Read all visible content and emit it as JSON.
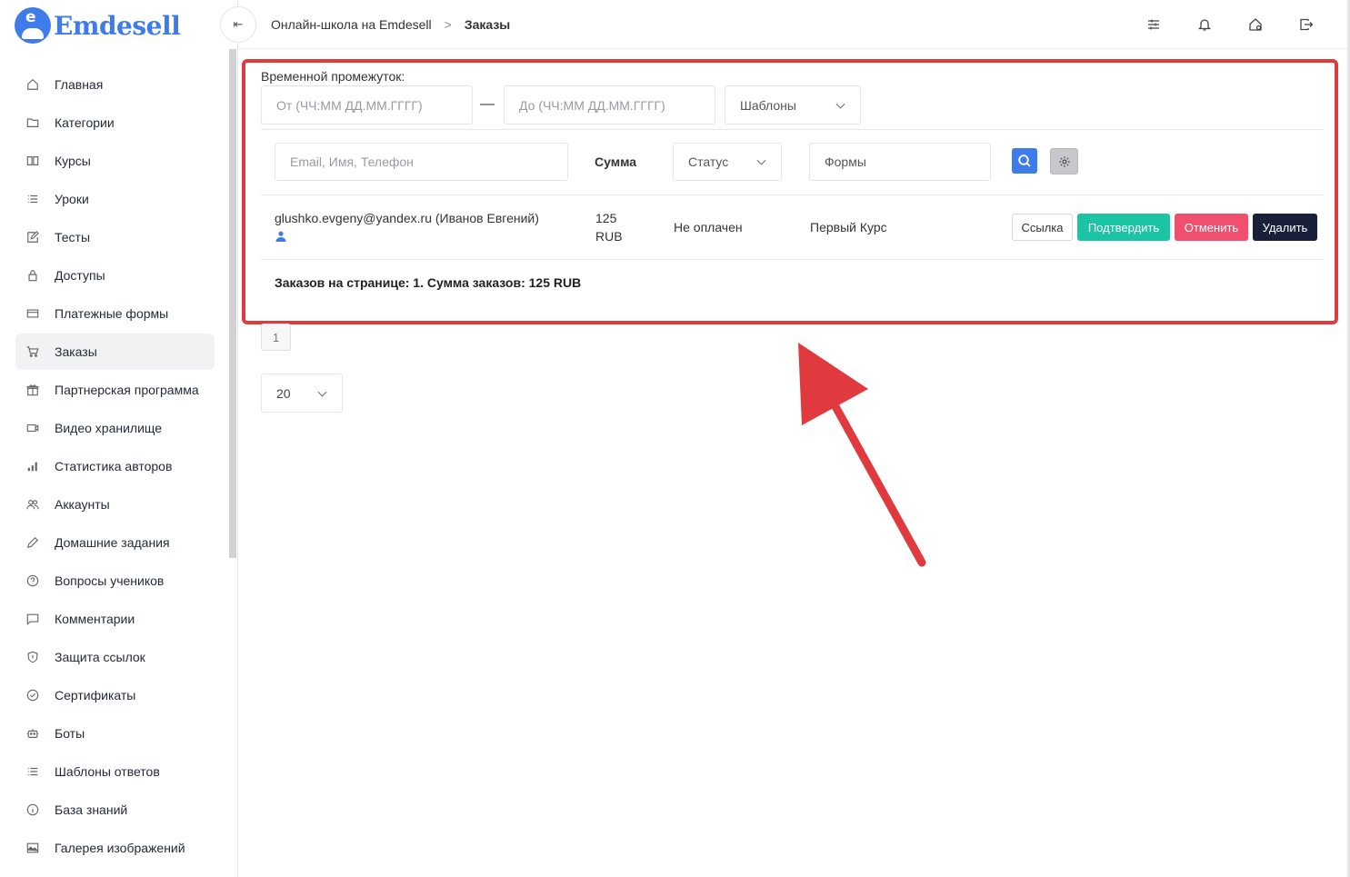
{
  "brand": {
    "name": "Emdesell",
    "logo_letter": "e",
    "color": "#3f7bea"
  },
  "sidebar": {
    "items": [
      {
        "label": "Главная",
        "icon": "home-icon"
      },
      {
        "label": "Категории",
        "icon": "folder-icon"
      },
      {
        "label": "Курсы",
        "icon": "book-icon"
      },
      {
        "label": "Уроки",
        "icon": "list-icon"
      },
      {
        "label": "Тесты",
        "icon": "edit-icon"
      },
      {
        "label": "Доступы",
        "icon": "lock-icon"
      },
      {
        "label": "Платежные формы",
        "icon": "credit-card-icon"
      },
      {
        "label": "Заказы",
        "icon": "cart-icon",
        "active": true
      },
      {
        "label": "Партнерская программа",
        "icon": "gift-icon"
      },
      {
        "label": "Видео хранилище",
        "icon": "video-icon"
      },
      {
        "label": "Статистика авторов",
        "icon": "bar-chart-icon"
      },
      {
        "label": "Аккаунты",
        "icon": "users-icon"
      },
      {
        "label": "Домашние задания",
        "icon": "pencil-icon"
      },
      {
        "label": "Вопросы учеников",
        "icon": "question-icon"
      },
      {
        "label": "Комментарии",
        "icon": "comment-icon"
      },
      {
        "label": "Защита ссылок",
        "icon": "shield-icon"
      },
      {
        "label": "Сертификаты",
        "icon": "check-circle-icon"
      },
      {
        "label": "Боты",
        "icon": "bot-icon"
      },
      {
        "label": "Шаблоны ответов",
        "icon": "list-icon"
      },
      {
        "label": "База знаний",
        "icon": "info-icon"
      },
      {
        "label": "Галерея изображений",
        "icon": "image-icon"
      }
    ]
  },
  "header": {
    "breadcrumb": [
      "Онлайн-школа на Emdesell",
      "Заказы"
    ],
    "separator": ">",
    "collapse_glyph": "⇤"
  },
  "filters": {
    "range_label": "Временной промежуток:",
    "from_placeholder": "От (ЧЧ:ММ ДД.ММ.ГГГГ)",
    "to_placeholder": "До (ЧЧ:ММ ДД.ММ.ГГГГ)",
    "dash": "—",
    "templates_label": "Шаблоны",
    "search_placeholder": "Email, Имя, Телефон",
    "sum_header": "Сумма",
    "status_label": "Статус",
    "forms_placeholder": "Формы"
  },
  "orders": [
    {
      "customer": "glushko.evgeny@yandex.ru (Иванов Евгений)",
      "amount": "125",
      "currency": "RUB",
      "status": "Не оплачен",
      "course": "Первый Курс"
    }
  ],
  "actions": {
    "link": "Ссылка",
    "confirm": "Подтвердить",
    "cancel": "Отменить",
    "delete": "Удалить",
    "colors": {
      "confirm": "#1bc5a3",
      "cancel": "#f0506e",
      "delete": "#1a1f3a"
    }
  },
  "summary": "Заказов на странице: 1. Сумма заказов: 125 RUB",
  "pagination": {
    "current_page": "1",
    "per_page": "20"
  },
  "annotation": {
    "highlight_color": "#e0393e"
  }
}
